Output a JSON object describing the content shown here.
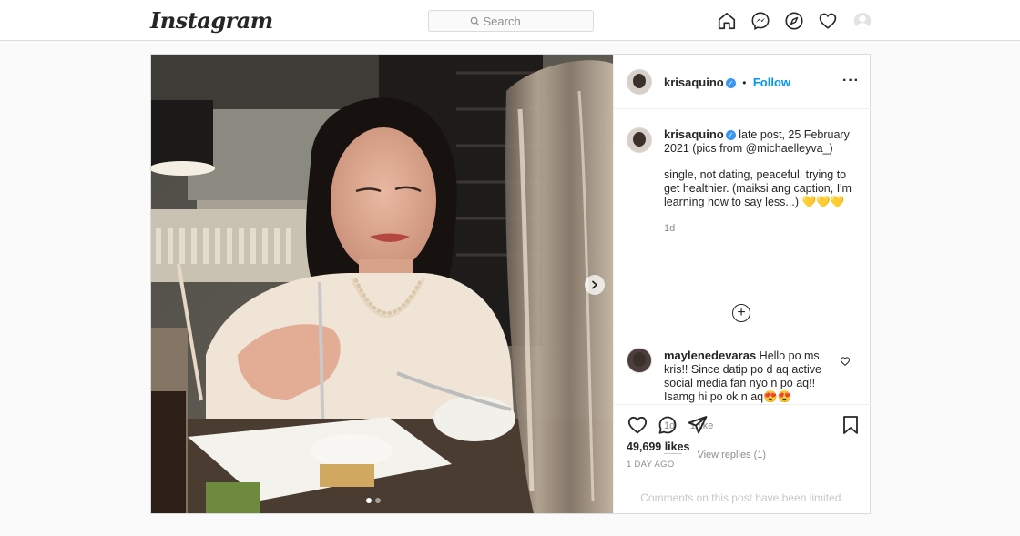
{
  "header": {
    "logo": "Instagram",
    "search_placeholder": "Search",
    "icons": [
      "home-icon",
      "messenger-icon",
      "explore-icon",
      "activity-heart-icon",
      "profile-avatar"
    ]
  },
  "post": {
    "author": "krisaquino",
    "follow_label": "Follow",
    "separator": "•",
    "more_label": "···",
    "caption_line1": "late post, 25 February 2021 (pics from @michaelleyva_)",
    "caption_line2": "single, not dating, peaceful, trying to get healthier. (maiksi ang caption, I'm learning how to say less...) 💛💛💛",
    "caption_age": "1d",
    "load_more_symbol": "+",
    "comments": [
      {
        "user": "maylenedevaras",
        "text": "Hello po ms kris!! Since datip po d aq active social media fan nyo n po aq!! Isamg hi po ok n aq😍😍",
        "age": "1d",
        "likes": "1 like",
        "view_replies": "View replies (1)"
      }
    ],
    "likes_count": "49,699 likes",
    "posted_ago": "1 DAY AGO",
    "comments_limited": "Comments on this post have been limited.",
    "carousel": {
      "total": 2,
      "active_index": 0
    }
  },
  "colors": {
    "link_blue": "#0095f6",
    "verified_blue": "#3897f0",
    "border": "#dbdbdb",
    "muted_text": "#8e8e8e"
  }
}
